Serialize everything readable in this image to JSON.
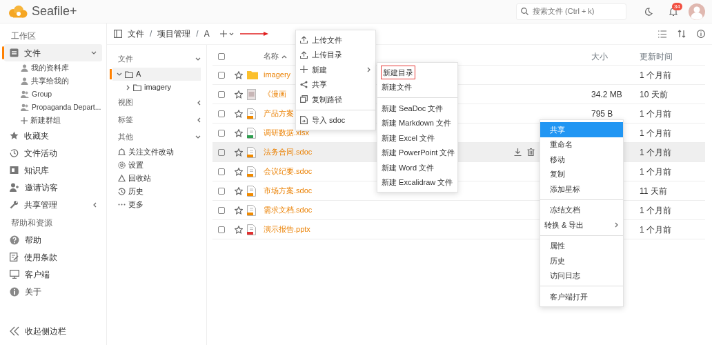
{
  "header": {
    "logo": "Seafile+",
    "search": {
      "placeholder": "搜索文件 (Ctrl + k)"
    },
    "notifications": "34"
  },
  "sidebar": {
    "sections": [
      {
        "heading": "工作区",
        "items": [
          {
            "label": "文件",
            "selected": true,
            "expanded": true,
            "children": [
              {
                "label": "我的资料库"
              },
              {
                "label": "共享给我的"
              },
              {
                "label": "Group"
              },
              {
                "label": "Propaganda Depart..."
              },
              {
                "label": "新建群组"
              }
            ]
          },
          {
            "label": "收藏夹",
            "selected": false
          },
          {
            "label": "文件活动",
            "selected": false
          },
          {
            "label": "知识库",
            "selected": false
          },
          {
            "label": "邀请访客",
            "selected": false
          },
          {
            "label": "共享管理",
            "selected": false,
            "expanded": false
          }
        ]
      },
      {
        "heading": "帮助和资源",
        "items": [
          {
            "label": "帮助",
            "selected": false
          },
          {
            "label": "使用条款",
            "selected": false
          },
          {
            "label": "客户端",
            "selected": false
          },
          {
            "label": "关于",
            "selected": false
          }
        ]
      }
    ],
    "collapse": "收起侧边栏"
  },
  "breadcrumb": {
    "parts": [
      "文件",
      "项目管理",
      "A"
    ],
    "separator": "/"
  },
  "tree": {
    "sections": [
      {
        "label": "文件",
        "expanded": true,
        "nodes": [
          {
            "label": "A",
            "selected": true,
            "expanded": true,
            "children": [
              {
                "label": "imagery",
                "selected": false,
                "expanded": false
              }
            ]
          }
        ]
      },
      {
        "label": "视图",
        "expanded": false
      },
      {
        "label": "标签",
        "expanded": false
      },
      {
        "label": "其他",
        "expanded": true,
        "items": [
          "关注文件改动",
          "设置",
          "回收站",
          "历史",
          "更多"
        ]
      }
    ]
  },
  "table": {
    "columns": [
      "名称",
      "大小",
      "更新时间"
    ],
    "sort_ascending": true,
    "all_checked": false,
    "rows": [
      {
        "name": "imagery",
        "kind": "folder",
        "size": "",
        "updated": "1 个月前",
        "checked": false,
        "starred": false,
        "hovered": false
      },
      {
        "name": "《漫画",
        "kind": "image",
        "size": "34.2 MB",
        "updated": "10 天前",
        "checked": false,
        "starred": false,
        "hovered": false
      },
      {
        "name": "产品方案",
        "kind": "sdoc",
        "size": "795 B",
        "updated": "1 个月前",
        "checked": false,
        "starred": false,
        "hovered": false
      },
      {
        "name": "调研数据.xlsx",
        "kind": "xlsx",
        "size": "",
        "updated": "1 个月前",
        "checked": false,
        "starred": false,
        "hovered": false
      },
      {
        "name": "法务合同.sdoc",
        "kind": "sdoc",
        "size": "",
        "updated": "1 个月前",
        "checked": false,
        "starred": false,
        "hovered": true
      },
      {
        "name": "会议纪要.sdoc",
        "kind": "sdoc",
        "size": "",
        "updated": "1 个月前",
        "checked": false,
        "starred": false,
        "hovered": false
      },
      {
        "name": "市场方案.sdoc",
        "kind": "sdoc",
        "size": "",
        "updated": "11 天前",
        "checked": false,
        "starred": false,
        "hovered": false
      },
      {
        "name": "需求文档.sdoc",
        "kind": "sdoc",
        "size": "",
        "updated": "1 个月前",
        "checked": false,
        "starred": false,
        "hovered": false
      },
      {
        "name": "演示报告.pptx",
        "kind": "pptx",
        "size": "",
        "updated": "1 个月前",
        "checked": false,
        "starred": false,
        "hovered": false
      }
    ]
  },
  "new_menu": {
    "groups": [
      [
        {
          "label": "上传文件",
          "submenu": false
        },
        {
          "label": "上传目录",
          "submenu": false
        },
        {
          "label": "新建",
          "submenu": true
        },
        {
          "label": "共享",
          "submenu": false
        },
        {
          "label": "复制路径",
          "submenu": false
        }
      ],
      [
        {
          "label": "导入 sdoc",
          "submenu": false
        }
      ]
    ]
  },
  "new_submenu": {
    "groups": [
      [
        {
          "label": "新建目录",
          "highlighted": true
        },
        {
          "label": "新建文件",
          "highlighted": false
        }
      ],
      [
        {
          "label": "新建 SeaDoc 文件",
          "highlighted": false
        },
        {
          "label": "新建 Markdown 文件",
          "highlighted": false
        },
        {
          "label": "新建 Excel 文件",
          "highlighted": false
        },
        {
          "label": "新建 PowerPoint 文件",
          "highlighted": false
        },
        {
          "label": "新建 Word 文件",
          "highlighted": false
        },
        {
          "label": "新建 Excalidraw 文件",
          "highlighted": false
        }
      ]
    ]
  },
  "context_menu": {
    "groups": [
      [
        {
          "label": "共享",
          "selected": true,
          "submenu": false
        },
        {
          "label": "重命名",
          "selected": false,
          "submenu": false
        },
        {
          "label": "移动",
          "selected": false,
          "submenu": false
        },
        {
          "label": "复制",
          "selected": false,
          "submenu": false
        },
        {
          "label": "添加星标",
          "selected": false,
          "submenu": false
        }
      ],
      [
        {
          "label": "冻结文档",
          "selected": false,
          "submenu": false
        },
        {
          "label": "转换 & 导出",
          "selected": false,
          "submenu": true
        }
      ],
      [
        {
          "label": "属性",
          "selected": false,
          "submenu": false
        },
        {
          "label": "历史",
          "selected": false,
          "submenu": false
        },
        {
          "label": "访问日志",
          "selected": false,
          "submenu": false
        }
      ],
      [
        {
          "label": "客户端打开",
          "selected": false,
          "submenu": false
        }
      ]
    ]
  }
}
